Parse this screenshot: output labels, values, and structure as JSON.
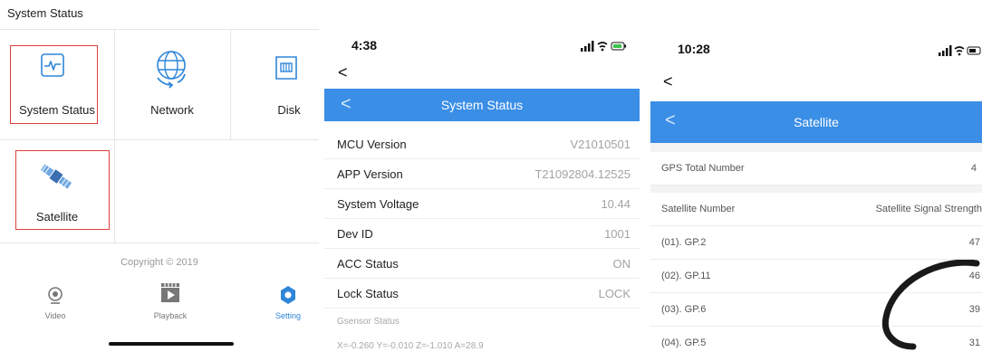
{
  "page_title": "System Status",
  "panel1": {
    "tiles": [
      {
        "label": "System Status",
        "icon": "pulse-icon"
      },
      {
        "label": "Network",
        "icon": "globe-icon"
      },
      {
        "label": "Disk",
        "icon": "sd-card-icon"
      },
      {
        "label": "Satellite",
        "icon": "satellite-icon"
      }
    ],
    "copyright": "Copyright © 2019",
    "tabs": [
      {
        "label": "Video",
        "icon": "camera-icon"
      },
      {
        "label": "Playback",
        "icon": "playback-icon"
      },
      {
        "label": "Setting",
        "icon": "gear-icon"
      }
    ],
    "highlight_color": "#e0403a",
    "active_color": "#2f86d8"
  },
  "panel2": {
    "time": "4:38",
    "back": "<",
    "header_back": "<",
    "header_title": "System Status",
    "rows": [
      {
        "key": "MCU Version",
        "value": "V21010501"
      },
      {
        "key": "APP Version",
        "value": "T21092804.12525"
      },
      {
        "key": "System Voltage",
        "value": "10.44"
      },
      {
        "key": "Dev ID",
        "value": "1001"
      },
      {
        "key": "ACC Status",
        "value": "ON"
      },
      {
        "key": "Lock Status",
        "value": "LOCK"
      }
    ],
    "gsensor_label": "Gsensor Status",
    "gsensor_value": "X=-0.260 Y=-0.010 Z=-1.010 A=28.9",
    "header_color": "#3a8ee6"
  },
  "panel3": {
    "time": "10:28",
    "back": "<",
    "header_back": "<",
    "header_title": "Satellite",
    "gps_total_label": "GPS Total Number",
    "gps_total_value": "4",
    "col_left": "Satellite Number",
    "col_right": "Satellite Signal Strength",
    "satellites": [
      {
        "number": "(01). GP.2",
        "strength": "47"
      },
      {
        "number": "(02). GP.11",
        "strength": "46"
      },
      {
        "number": "(03). GP.6",
        "strength": "39"
      },
      {
        "number": "(04). GP.5",
        "strength": "31"
      }
    ]
  }
}
